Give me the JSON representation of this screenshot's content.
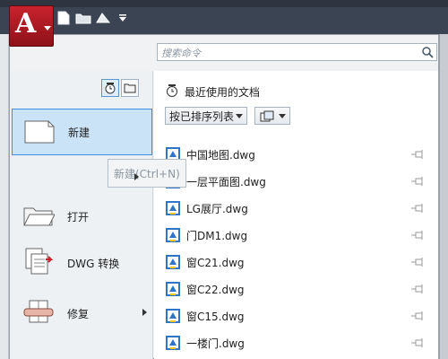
{
  "app": {
    "logo_letter": "A"
  },
  "quick_access": [
    {
      "icon": "new-file-icon"
    },
    {
      "icon": "open-folder-icon"
    },
    {
      "icon": "save-icon"
    },
    {
      "icon": "dropdown-icon"
    }
  ],
  "search": {
    "placeholder": "搜索命令"
  },
  "left_menu": [
    {
      "label": "新建",
      "icon": "new-document-icon",
      "selected": true
    },
    {
      "label": "打开",
      "icon": "open-folder-icon"
    },
    {
      "label": "DWG 转换",
      "icon": "dwg-convert-icon"
    },
    {
      "label": "修复",
      "icon": "repair-icon",
      "has_submenu": true
    }
  ],
  "recent": {
    "title": "最近使用的文档",
    "sort_label": "按已排序列表",
    "files": [
      "中国地图.dwg",
      "一层平面图.dwg",
      "LG展厅.dwg",
      "门DM1.dwg",
      "窗C21.dwg",
      "窗C22.dwg",
      "窗C15.dwg",
      "一楼门.dwg"
    ]
  },
  "tooltip": {
    "text": "新建(Ctrl+N)"
  },
  "colors": {
    "accent": "#3c8ee0",
    "titlebar": "#3b4453",
    "logo": "#c8232d"
  }
}
